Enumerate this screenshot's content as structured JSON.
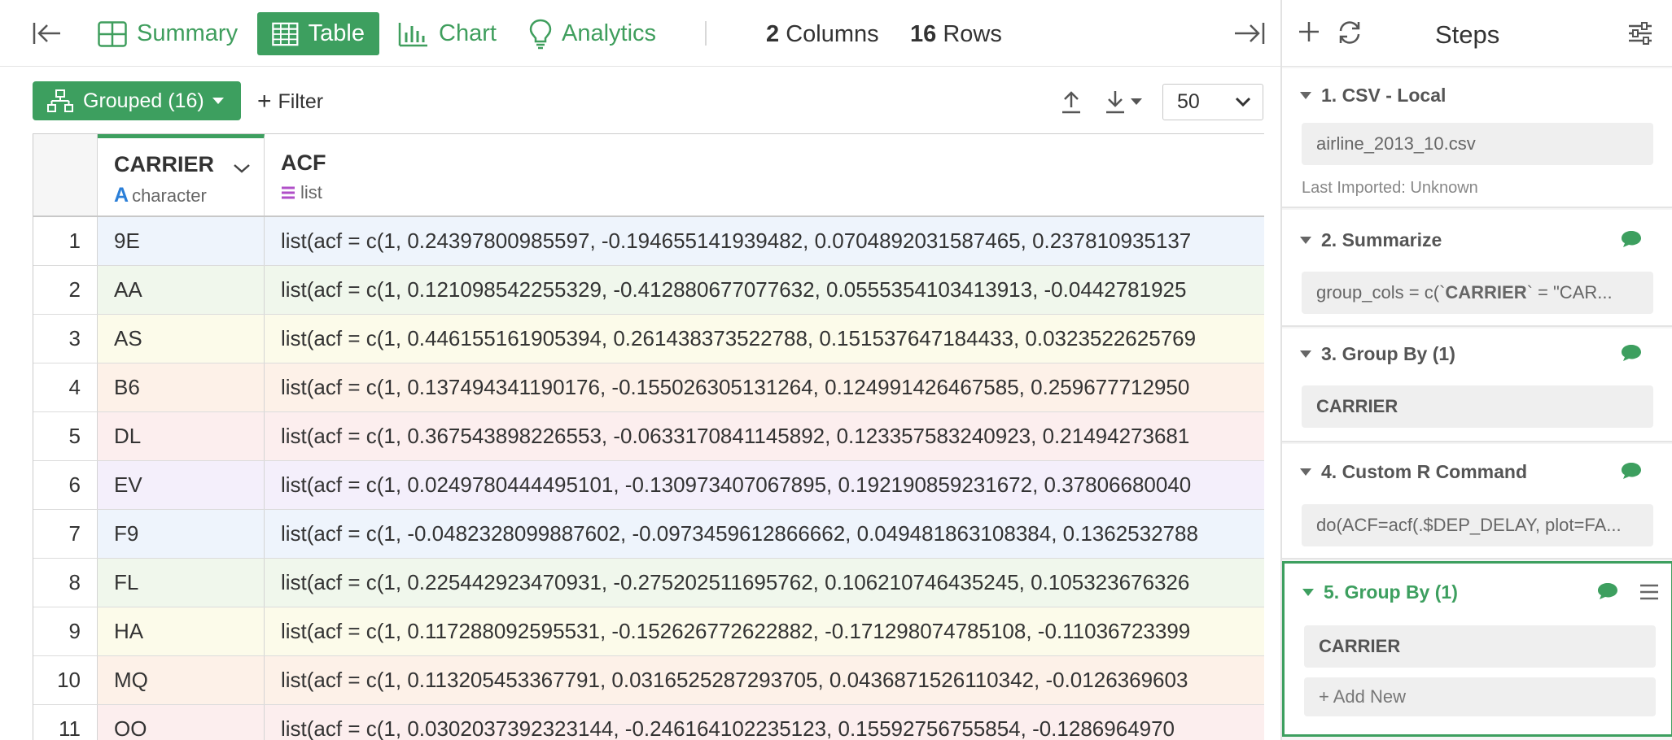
{
  "toolbar": {
    "tabs": [
      {
        "label": "Summary",
        "icon": "summary-grid-icon"
      },
      {
        "label": "Table",
        "icon": "table-icon",
        "active": true
      },
      {
        "label": "Chart",
        "icon": "bar-chart-icon"
      },
      {
        "label": "Analytics",
        "icon": "lightbulb-icon"
      }
    ],
    "columns_count": "2",
    "columns_label": "Columns",
    "rows_count": "16",
    "rows_label": "Rows"
  },
  "subtoolbar": {
    "grouped_label": "Grouped (16)",
    "filter_label": "Filter",
    "page_size": "50"
  },
  "table": {
    "columns": [
      {
        "name": "CARRIER",
        "type": "character"
      },
      {
        "name": "ACF",
        "type": "list"
      }
    ],
    "rows": [
      {
        "num": "1",
        "carrier": "9E",
        "acf": "list(acf = c(1, 0.24397800985597, -0.194655141939482, 0.0704892031587465, 0.237810935137",
        "color": "#eef4fc"
      },
      {
        "num": "2",
        "carrier": "AA",
        "acf": "list(acf = c(1, 0.121098542255329, -0.412880677077632, 0.0555354103413913, -0.0442781925",
        "color": "#f0f7ec"
      },
      {
        "num": "3",
        "carrier": "AS",
        "acf": "list(acf = c(1, 0.446155161905394, 0.261438373522788, 0.151537647184433, 0.0323522625769",
        "color": "#fcfbea"
      },
      {
        "num": "4",
        "carrier": "B6",
        "acf": "list(acf = c(1, 0.137494341190176, -0.155026305131264, 0.124991426467585, 0.259677712950",
        "color": "#fdf1e8"
      },
      {
        "num": "5",
        "carrier": "DL",
        "acf": "list(acf = c(1, 0.367543898226553, -0.0633170841145892, 0.123357583240923, 0.21494273681",
        "color": "#fceeee"
      },
      {
        "num": "6",
        "carrier": "EV",
        "acf": "list(acf = c(1, 0.0249780444495101, -0.130973407067895, 0.192190859231672, 0.37806680040",
        "color": "#f4effb"
      },
      {
        "num": "7",
        "carrier": "F9",
        "acf": "list(acf = c(1, -0.0482328099887602, -0.0973459612866662, 0.049481863108384, 0.1362532788",
        "color": "#eef4fc"
      },
      {
        "num": "8",
        "carrier": "FL",
        "acf": "list(acf = c(1, 0.225442923470931, -0.275202511695762, 0.106210746435245, 0.105323676326",
        "color": "#f0f7ec"
      },
      {
        "num": "9",
        "carrier": "HA",
        "acf": "list(acf = c(1, 0.117288092595531, -0.152626772622882, -0.171298074785108, -0.11036723399",
        "color": "#fcfbea"
      },
      {
        "num": "10",
        "carrier": "MQ",
        "acf": "list(acf = c(1, 0.113205453367791, 0.0316525287293705, 0.0436871526110342, -0.0126369603",
        "color": "#fdf1e8"
      },
      {
        "num": "11",
        "carrier": "OO",
        "acf": "list(acf = c(1, 0.0302037392323144, -0.246164102235123, 0.15592756755854, -0.1286964970",
        "color": "#fceeee"
      }
    ]
  },
  "steps": {
    "title": "Steps",
    "items": [
      {
        "title": "1. CSV - Local",
        "box": "airline_2013_10.csv",
        "note": "Last Imported: Unknown"
      },
      {
        "title": "2. Summarize",
        "box_pre": "group_cols = c(`",
        "box_bold": "CARRIER",
        "box_post": "` = \"CAR..."
      },
      {
        "title": "3. Group By (1)",
        "box": "CARRIER"
      },
      {
        "title": "4. Custom R Command",
        "box": "do(ACF=acf(.$DEP_DELAY, plot=FA..."
      },
      {
        "title": "5. Group By (1)",
        "box": "CARRIER",
        "add_new": "Add New"
      }
    ]
  },
  "colors": {
    "accent": "#3d9f5f",
    "list_type": "#b04fc8",
    "char_type": "#2b7fd8"
  }
}
